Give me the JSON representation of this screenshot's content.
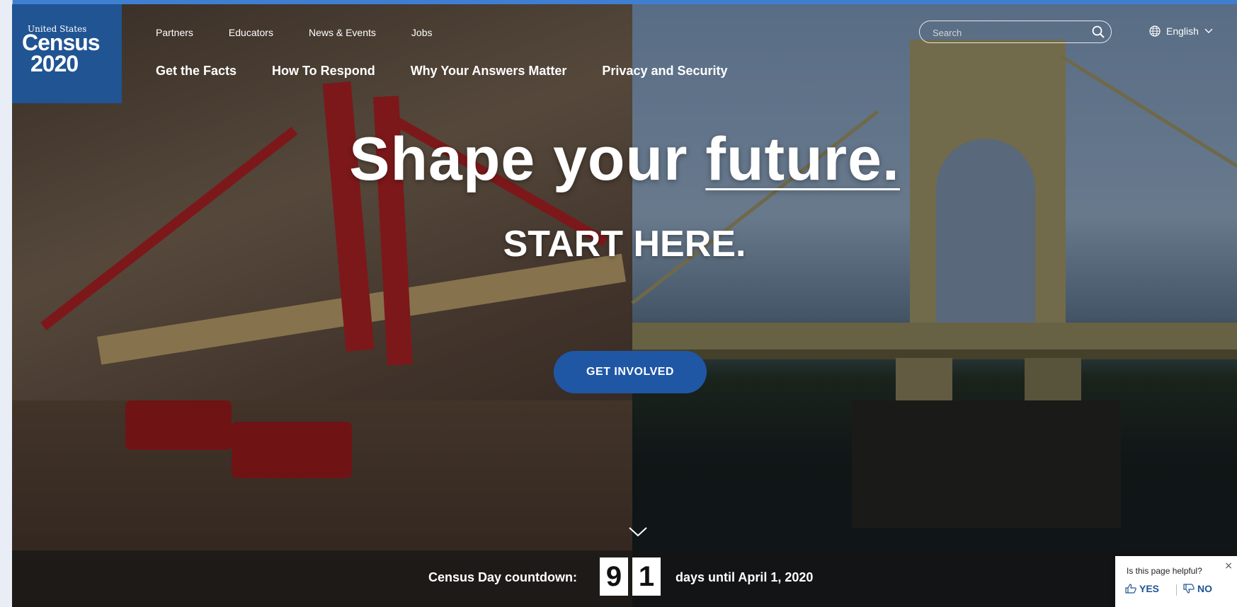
{
  "logo": {
    "line1": "United States",
    "line2": "Census",
    "line3": "2020"
  },
  "top_nav": [
    "Partners",
    "Educators",
    "News & Events",
    "Jobs"
  ],
  "main_nav": [
    "Get the Facts",
    "How To Respond",
    "Why Your Answers Matter",
    "Privacy and Security"
  ],
  "search": {
    "placeholder": "Search"
  },
  "language": {
    "label": "English"
  },
  "hero": {
    "headline_part1": "Shape your ",
    "headline_part2": "future.",
    "subhead": "START HERE.",
    "cta_label": "GET INVOLVED"
  },
  "countdown": {
    "label": "Census Day countdown:",
    "digit1": "9",
    "digit2": "1",
    "suffix": "days until April 1, 2020"
  },
  "feedback": {
    "question": "Is this page helpful?",
    "yes": "YES",
    "no": "NO",
    "close": "×"
  },
  "colors": {
    "brand_blue": "#205493",
    "cta_blue": "#1f57a5"
  },
  "icons": [
    "search-icon",
    "globe-icon",
    "chevron-down-icon",
    "thumbs-up-icon",
    "thumbs-down-icon",
    "close-icon"
  ]
}
